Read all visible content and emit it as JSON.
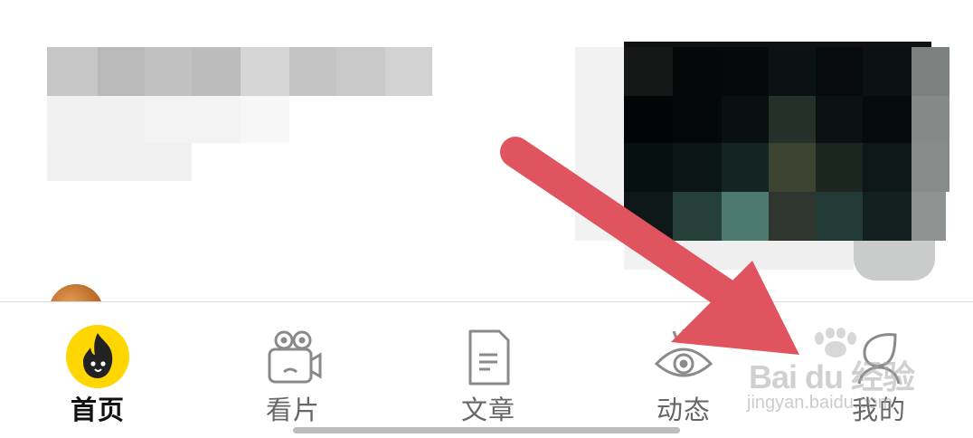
{
  "tabs": [
    {
      "label": "首页",
      "icon": "flame-mascot-icon",
      "active": true
    },
    {
      "label": "看片",
      "icon": "film-camera-icon",
      "active": false
    },
    {
      "label": "文章",
      "icon": "document-icon",
      "active": false
    },
    {
      "label": "动态",
      "icon": "eye-icon",
      "active": false
    },
    {
      "label": "我的",
      "icon": "profile-leaf-icon",
      "active": false
    }
  ],
  "watermark": {
    "brand": "Bai du 经验",
    "url": "jingyan.baidu.com"
  },
  "colors": {
    "active_tab_bg": "#FFD600",
    "arrow": "#E0545F",
    "icon_gray": "#8a8a8a"
  }
}
